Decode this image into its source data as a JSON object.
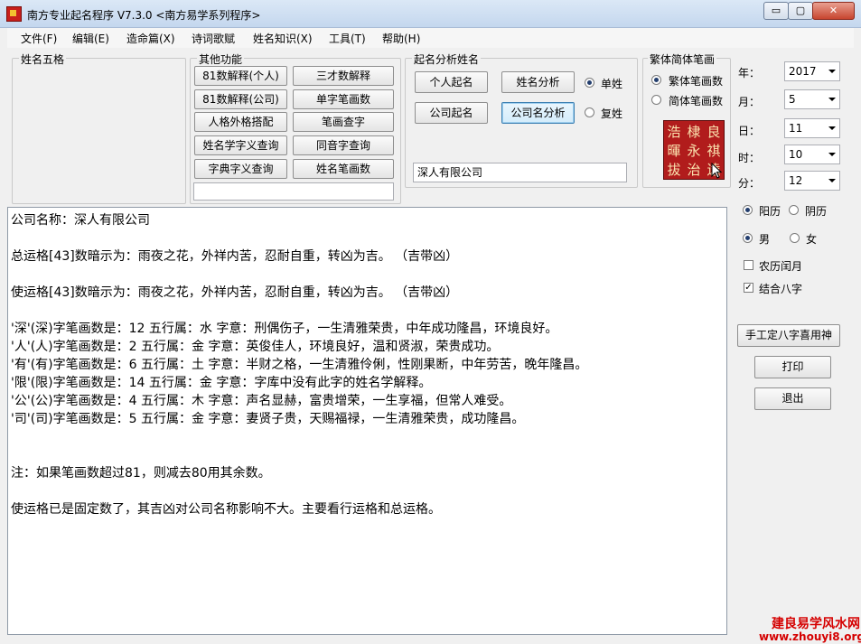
{
  "window": {
    "title": "南方专业起名程序 V7.3.0  <南方易学系列程序>",
    "controls": {
      "minimize": "▭",
      "restore": "▢",
      "close": "✕"
    }
  },
  "menu": [
    "文件(F)",
    "编辑(E)",
    "造命篇(X)",
    "诗词歌赋",
    "姓名知识(X)",
    "工具(T)",
    "帮助(H)"
  ],
  "groups": {
    "name_wuge": "姓名五格",
    "other_functions": "其他功能",
    "analysis": "起名分析姓名",
    "traditional_simplified": "繁体简体笔画"
  },
  "other_buttons": [
    "81数解释(个人)",
    "三才数解释",
    "81数解释(公司)",
    "单字笔画数",
    "人格外格搭配",
    "笔画查字",
    "姓名学字义查询",
    "同音字查询",
    "字典字义查询",
    "姓名笔画数"
  ],
  "other_input": "",
  "analysis_buttons": {
    "personal_naming": "个人起名",
    "name_analysis": "姓名分析",
    "company_naming": "公司起名",
    "company_analysis": "公司名分析"
  },
  "surname_type": {
    "single": "单姓",
    "compound": "复姓",
    "selected": "single"
  },
  "name_input": "深人有限公司",
  "stroke_type": {
    "traditional": "繁体笔画数",
    "simplified": "简体笔画数",
    "selected": "traditional"
  },
  "calligraphy": [
    "浩",
    "棣",
    "良",
    "暉",
    "永",
    "祺",
    "拔",
    "治",
    "逵"
  ],
  "date": {
    "year": {
      "label": "年：",
      "value": "2017"
    },
    "month": {
      "label": "月：",
      "value": "5"
    },
    "day": {
      "label": "日：",
      "value": "11"
    },
    "hour": {
      "label": "时：",
      "value": "10"
    },
    "minute": {
      "label": "分：",
      "value": "12"
    }
  },
  "calendar": {
    "solar": "阳历",
    "lunar": "阴历",
    "selected": "solar"
  },
  "gender": {
    "male": "男",
    "female": "女",
    "selected": "male"
  },
  "options": {
    "lunar_leap": "农历闰月",
    "lunar_leap_checked": false,
    "combine_bazi": "结合八字",
    "combine_bazi_checked": true
  },
  "side_buttons": {
    "manual_bazi": "手工定八字喜用神",
    "print": "打印",
    "exit": "退出"
  },
  "result_lines": [
    "公司名称：深人有限公司",
    "",
    "总运格[43]数暗示为：雨夜之花，外祥内苦，忍耐自重，转凶为吉。 （吉带凶）",
    "",
    "使运格[43]数暗示为：雨夜之花，外祥内苦，忍耐自重，转凶为吉。 （吉带凶）",
    "",
    "'深'(深)字笔画数是：12  五行属：水  字意：刑偶伤子，一生清雅荣贵，中年成功隆昌，环境良好。",
    "'人'(人)字笔画数是：2   五行属：金  字意：英俊佳人，环境良好，温和贤淑，荣贵成功。",
    "'有'(有)字笔画数是：6   五行属：土  字意：半财之格，一生清雅伶俐，性刚果断，中年劳苦，晚年隆昌。",
    "'限'(限)字笔画数是：14  五行属：金  字意：字库中没有此字的姓名学解释。",
    "'公'(公)字笔画数是：4   五行属：木  字意：声名显赫，富贵增荣，一生享福，但常人难受。",
    "'司'(司)字笔画数是：5   五行属：金  字意：妻贤子贵，天赐福禄，一生清雅荣贵，成功隆昌。",
    "",
    "",
    "注：如果笔画数超过81，则减去80用其余数。",
    "",
    "使运格已是固定数了，其吉凶对公司名称影响不大。主要看行运格和总运格。"
  ],
  "watermark": {
    "line1": "建良易学风水网",
    "line2": "www.zhouyi8.org"
  }
}
